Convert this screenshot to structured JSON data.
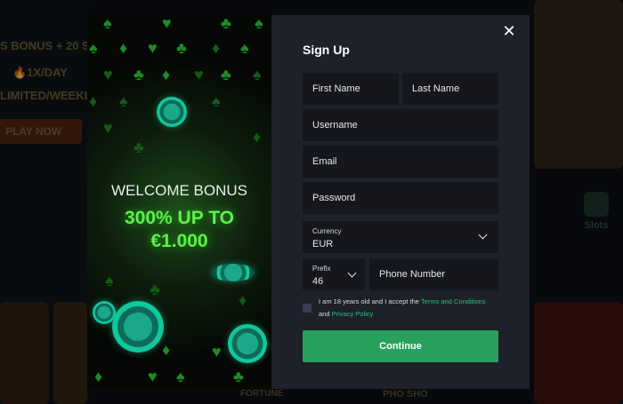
{
  "background": {
    "promo_line_1": "S BONUS + 20 S",
    "promo_line_2": "🔥1X/DAY",
    "promo_line_3": "LIMITED/WEEKL",
    "play_button": "PLAY NOW",
    "slots_label": "Slots",
    "tile_1": "FORTUNE",
    "tile_2": "PHO SHO"
  },
  "promo": {
    "title": "WELCOME BONUS",
    "amount_line1": "300% UP TO",
    "amount_line2": "€1.000",
    "accent": "#5df14a"
  },
  "signup": {
    "title": "Sign Up",
    "close_icon": "close-icon",
    "first_name_placeholder": "First Name",
    "last_name_placeholder": "Last Name",
    "username_placeholder": "Username",
    "email_placeholder": "Email",
    "password_placeholder": "Password",
    "currency_label": "Currency",
    "currency_value": "EUR",
    "prefix_label": "Prefix",
    "prefix_value": "46",
    "phone_placeholder": "Phone Number",
    "terms_text_1": "I am 18 years old and I accept the ",
    "terms_link_1": "Terms and Conditions",
    "terms_text_2": "and ",
    "terms_link_2": "Privacy Policy",
    "continue_label": "Continue",
    "continue_color": "#27a05e"
  }
}
